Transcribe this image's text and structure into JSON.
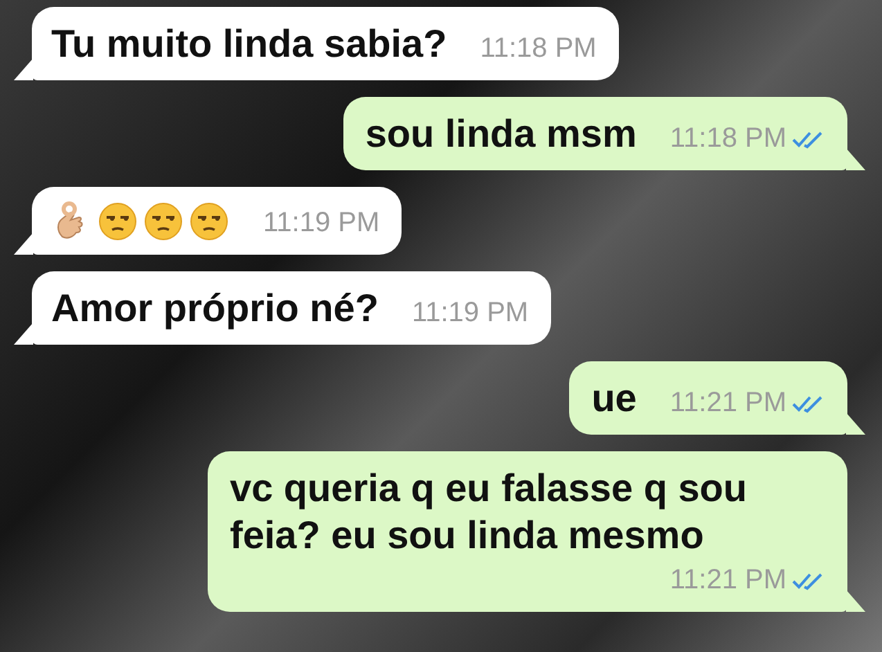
{
  "messages": [
    {
      "outgoing": false,
      "kind": "text",
      "text": "Tu muito linda sabia?",
      "time": "11:18 PM"
    },
    {
      "outgoing": true,
      "kind": "text",
      "text": "sou linda msm",
      "time": "11:18 PM",
      "read": true
    },
    {
      "outgoing": false,
      "kind": "emoji",
      "time": "11:19 PM"
    },
    {
      "outgoing": false,
      "kind": "text",
      "text": "Amor próprio né?",
      "time": "11:19 PM"
    },
    {
      "outgoing": true,
      "kind": "text",
      "text": "ue",
      "time": "11:21 PM",
      "read": true
    },
    {
      "outgoing": true,
      "kind": "text",
      "text": "vc queria q eu falasse q sou feia? eu sou linda mesmo",
      "time": "11:21 PM",
      "read": true
    }
  ]
}
